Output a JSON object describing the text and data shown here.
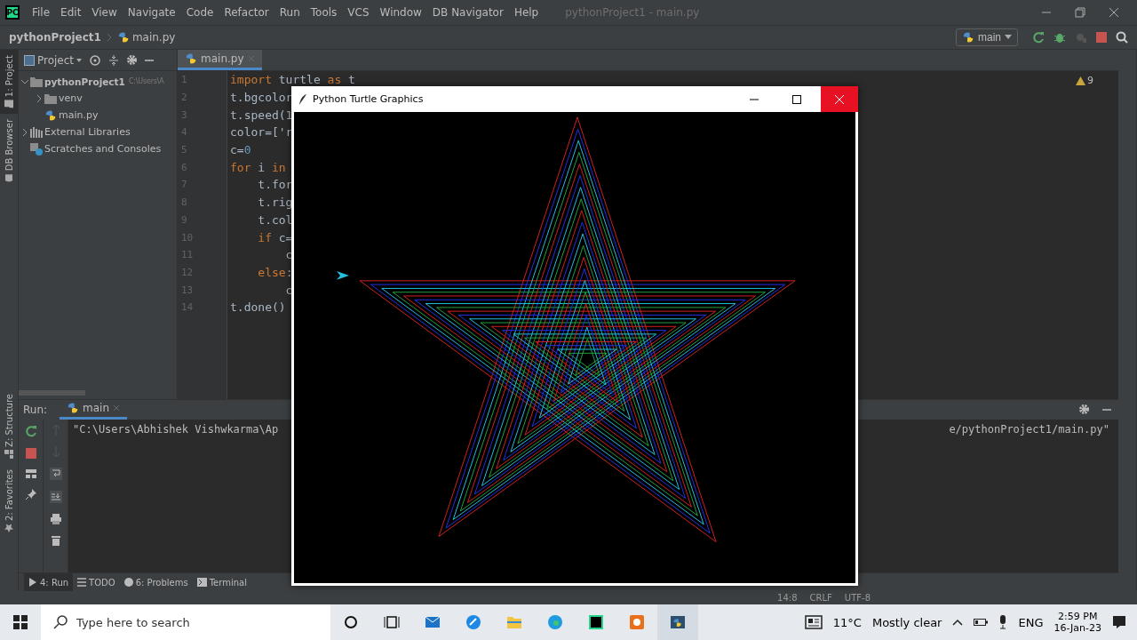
{
  "ide": {
    "app_badge": "PC",
    "menu": [
      "File",
      "Edit",
      "View",
      "Navigate",
      "Code",
      "Refactor",
      "Run",
      "Tools",
      "VCS",
      "Window",
      "DB Navigator",
      "Help"
    ],
    "window_title": "pythonProject1 - main.py",
    "breadcrumbs": [
      "pythonProject1",
      "main.py"
    ],
    "run_config": "main",
    "left_stripe": [
      {
        "label": "1: Project",
        "selected": true
      },
      {
        "label": "DB Browser",
        "selected": false
      }
    ],
    "bottom_stripe": [
      {
        "label": "Z: Structure",
        "selected": false
      },
      {
        "label": "2: Favorites",
        "selected": false
      }
    ],
    "project_panel": {
      "title": "Project",
      "tree": [
        {
          "label": "pythonProject1",
          "path": "C:\\Users\\A",
          "kind": "folder",
          "expanded": true,
          "children": [
            {
              "label": "venv",
              "kind": "folder",
              "expanded": false
            },
            {
              "label": "main.py",
              "kind": "python"
            }
          ]
        },
        {
          "label": "External Libraries",
          "kind": "library",
          "expanded": false
        },
        {
          "label": "Scratches and Consoles",
          "kind": "scratch"
        }
      ]
    },
    "editor": {
      "tabs": [
        {
          "label": "main.py",
          "selected": true
        }
      ],
      "inspection_count": "9",
      "lines": [
        {
          "number": "1",
          "tokens": [
            {
              "text": "import",
              "kind": "keyword"
            },
            {
              "text": " turtle ",
              "kind": "plain"
            },
            {
              "text": "as",
              "kind": "keyword"
            },
            {
              "text": " t",
              "kind": "plain"
            }
          ]
        },
        {
          "number": "2",
          "tokens": [
            {
              "text": "t.bgcolor",
              "kind": "plain"
            }
          ]
        },
        {
          "number": "3",
          "tokens": [
            {
              "text": "t.speed(1",
              "kind": "plain"
            }
          ]
        },
        {
          "number": "4",
          "tokens": [
            {
              "text": "color=['r",
              "kind": "plain"
            }
          ]
        },
        {
          "number": "5",
          "tokens": [
            {
              "text": "c=",
              "kind": "plain"
            },
            {
              "text": "0",
              "kind": "number"
            }
          ]
        },
        {
          "number": "6",
          "tokens": [
            {
              "text": "for",
              "kind": "keyword"
            },
            {
              "text": " i ",
              "kind": "plain"
            },
            {
              "text": "in",
              "kind": "keyword"
            }
          ]
        },
        {
          "number": "7",
          "tokens": [
            {
              "text": "    t.for",
              "kind": "plain"
            }
          ]
        },
        {
          "number": "8",
          "tokens": [
            {
              "text": "    t.rig",
              "kind": "plain"
            }
          ]
        },
        {
          "number": "9",
          "tokens": [
            {
              "text": "    t.col",
              "kind": "plain"
            }
          ]
        },
        {
          "number": "10",
          "tokens": [
            {
              "text": "    if",
              "kind": "keyword"
            },
            {
              "text": " c=",
              "kind": "plain"
            }
          ]
        },
        {
          "number": "11",
          "tokens": [
            {
              "text": "        c",
              "kind": "plain"
            }
          ]
        },
        {
          "number": "12",
          "tokens": [
            {
              "text": "    else",
              "kind": "keyword"
            },
            {
              "text": ":",
              "kind": "plain"
            }
          ]
        },
        {
          "number": "13",
          "tokens": [
            {
              "text": "        c",
              "kind": "plain"
            }
          ]
        },
        {
          "number": "14",
          "tokens": [
            {
              "text": "t.done()",
              "kind": "plain"
            }
          ]
        }
      ]
    },
    "run_panel": {
      "label": "Run:",
      "tabs": [
        {
          "label": "main",
          "selected": true
        }
      ],
      "console_left": "\"C:\\Users\\Abhishek Vishwkarma\\Ap",
      "console_right": "e/pythonProject1/main.py\""
    },
    "tool_tabs": [
      {
        "label": "4: Run",
        "selected": true
      },
      {
        "label": "TODO",
        "selected": false
      },
      {
        "label": "6: Problems",
        "selected": false
      },
      {
        "label": "Terminal",
        "selected": false
      }
    ],
    "status_bar": [
      "14:8",
      "CRLF",
      "UTF-8"
    ]
  },
  "turtle_window": {
    "title": "Python Turtle Graphics"
  },
  "taskbar": {
    "search_placeholder": "Type here to search",
    "temperature": "11°C",
    "condition": "Mostly clear",
    "language": "ENG",
    "time": "2:59 PM",
    "date": "16-Jan-23"
  }
}
